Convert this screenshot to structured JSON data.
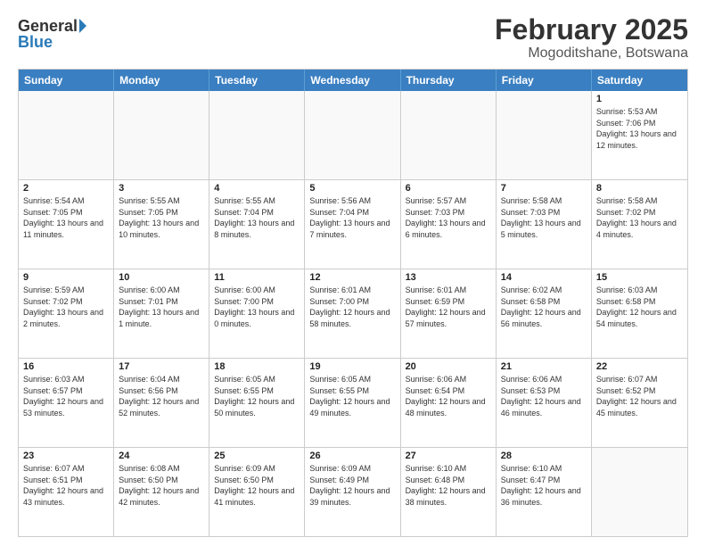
{
  "header": {
    "logo_general": "General",
    "logo_blue": "Blue",
    "month": "February 2025",
    "location": "Mogoditshane, Botswana"
  },
  "days_of_week": [
    "Sunday",
    "Monday",
    "Tuesday",
    "Wednesday",
    "Thursday",
    "Friday",
    "Saturday"
  ],
  "weeks": [
    [
      {
        "day": "",
        "empty": true
      },
      {
        "day": "",
        "empty": true
      },
      {
        "day": "",
        "empty": true
      },
      {
        "day": "",
        "empty": true
      },
      {
        "day": "",
        "empty": true
      },
      {
        "day": "",
        "empty": true
      },
      {
        "day": "1",
        "sunrise": "5:53 AM",
        "sunset": "7:06 PM",
        "daylight": "13 hours and 12 minutes."
      }
    ],
    [
      {
        "day": "2",
        "sunrise": "5:54 AM",
        "sunset": "7:05 PM",
        "daylight": "13 hours and 11 minutes."
      },
      {
        "day": "3",
        "sunrise": "5:55 AM",
        "sunset": "7:05 PM",
        "daylight": "13 hours and 10 minutes."
      },
      {
        "day": "4",
        "sunrise": "5:55 AM",
        "sunset": "7:04 PM",
        "daylight": "13 hours and 8 minutes."
      },
      {
        "day": "5",
        "sunrise": "5:56 AM",
        "sunset": "7:04 PM",
        "daylight": "13 hours and 7 minutes."
      },
      {
        "day": "6",
        "sunrise": "5:57 AM",
        "sunset": "7:03 PM",
        "daylight": "13 hours and 6 minutes."
      },
      {
        "day": "7",
        "sunrise": "5:58 AM",
        "sunset": "7:03 PM",
        "daylight": "13 hours and 5 minutes."
      },
      {
        "day": "8",
        "sunrise": "5:58 AM",
        "sunset": "7:02 PM",
        "daylight": "13 hours and 4 minutes."
      }
    ],
    [
      {
        "day": "9",
        "sunrise": "5:59 AM",
        "sunset": "7:02 PM",
        "daylight": "13 hours and 2 minutes."
      },
      {
        "day": "10",
        "sunrise": "6:00 AM",
        "sunset": "7:01 PM",
        "daylight": "13 hours and 1 minute."
      },
      {
        "day": "11",
        "sunrise": "6:00 AM",
        "sunset": "7:00 PM",
        "daylight": "13 hours and 0 minutes."
      },
      {
        "day": "12",
        "sunrise": "6:01 AM",
        "sunset": "7:00 PM",
        "daylight": "12 hours and 58 minutes."
      },
      {
        "day": "13",
        "sunrise": "6:01 AM",
        "sunset": "6:59 PM",
        "daylight": "12 hours and 57 minutes."
      },
      {
        "day": "14",
        "sunrise": "6:02 AM",
        "sunset": "6:58 PM",
        "daylight": "12 hours and 56 minutes."
      },
      {
        "day": "15",
        "sunrise": "6:03 AM",
        "sunset": "6:58 PM",
        "daylight": "12 hours and 54 minutes."
      }
    ],
    [
      {
        "day": "16",
        "sunrise": "6:03 AM",
        "sunset": "6:57 PM",
        "daylight": "12 hours and 53 minutes."
      },
      {
        "day": "17",
        "sunrise": "6:04 AM",
        "sunset": "6:56 PM",
        "daylight": "12 hours and 52 minutes."
      },
      {
        "day": "18",
        "sunrise": "6:05 AM",
        "sunset": "6:55 PM",
        "daylight": "12 hours and 50 minutes."
      },
      {
        "day": "19",
        "sunrise": "6:05 AM",
        "sunset": "6:55 PM",
        "daylight": "12 hours and 49 minutes."
      },
      {
        "day": "20",
        "sunrise": "6:06 AM",
        "sunset": "6:54 PM",
        "daylight": "12 hours and 48 minutes."
      },
      {
        "day": "21",
        "sunrise": "6:06 AM",
        "sunset": "6:53 PM",
        "daylight": "12 hours and 46 minutes."
      },
      {
        "day": "22",
        "sunrise": "6:07 AM",
        "sunset": "6:52 PM",
        "daylight": "12 hours and 45 minutes."
      }
    ],
    [
      {
        "day": "23",
        "sunrise": "6:07 AM",
        "sunset": "6:51 PM",
        "daylight": "12 hours and 43 minutes."
      },
      {
        "day": "24",
        "sunrise": "6:08 AM",
        "sunset": "6:50 PM",
        "daylight": "12 hours and 42 minutes."
      },
      {
        "day": "25",
        "sunrise": "6:09 AM",
        "sunset": "6:50 PM",
        "daylight": "12 hours and 41 minutes."
      },
      {
        "day": "26",
        "sunrise": "6:09 AM",
        "sunset": "6:49 PM",
        "daylight": "12 hours and 39 minutes."
      },
      {
        "day": "27",
        "sunrise": "6:10 AM",
        "sunset": "6:48 PM",
        "daylight": "12 hours and 38 minutes."
      },
      {
        "day": "28",
        "sunrise": "6:10 AM",
        "sunset": "6:47 PM",
        "daylight": "12 hours and 36 minutes."
      },
      {
        "day": "",
        "empty": true
      }
    ]
  ]
}
